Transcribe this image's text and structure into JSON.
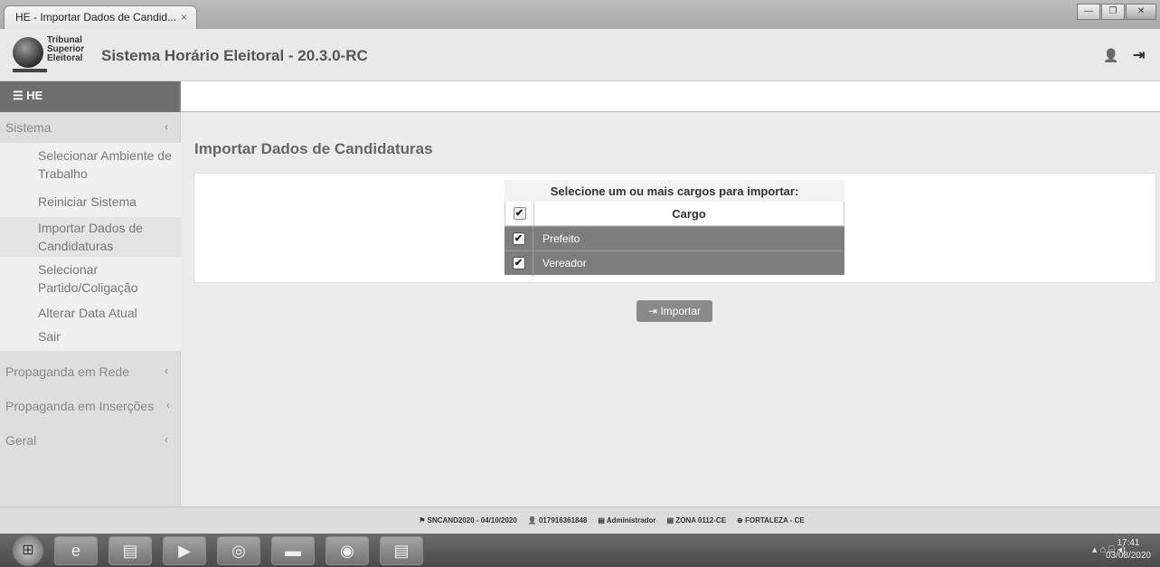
{
  "browser": {
    "tab_title": "HE - Importar Dados de Candid...",
    "tab_close": "×",
    "win_min": "—",
    "win_max": "❐",
    "win_close": "✕"
  },
  "header": {
    "org_line1": "Tribunal",
    "org_line2": "Superior",
    "org_line3": "Eleitoral",
    "app_title": "Sistema Horário Eleitoral - 20.3.0-RC",
    "user_icon": "👤",
    "logout_icon": "⇥"
  },
  "menu": {
    "toggle_label": "☰ HE"
  },
  "sidebar": {
    "sistema": {
      "label": "Sistema",
      "chev": "‹"
    },
    "sub": [
      "Selecionar Ambiente de Trabalho",
      "Reiniciar Sistema",
      "Importar Dados de Candidaturas",
      "Selecionar Partido/Coligação",
      "Alterar Data Atual",
      "Sair"
    ],
    "propaganda_rede": {
      "label": "Propaganda em Rede",
      "chev": "‹"
    },
    "propaganda_insercoes": {
      "label": "Propaganda em Inserções",
      "chev": "‹"
    },
    "geral": {
      "label": "Geral",
      "chev": "‹"
    }
  },
  "main": {
    "title": "Importar Dados de Candidaturas",
    "table_caption": "Selecione um ou mais cargos para importar:",
    "column_header": "Cargo",
    "rows": [
      "Prefeito",
      "Vereador"
    ],
    "check": "✔",
    "import_button": "⇥ Importar"
  },
  "status": {
    "base": "⚑ SNCAND2020 - 04/10/2020",
    "user": "👤 017916361848",
    "role": "▤ Administrador",
    "zona": "▤ ZONA 0112-CE",
    "city": "⊕ FORTALEZA  -  CE"
  },
  "taskbar": {
    "start": "⊞",
    "ie": "e",
    "files": "▤",
    "media": "▶",
    "chrome": "◎",
    "screen": "▬",
    "globe": "◉",
    "doc": "▤",
    "tray": "▴  ⌂  ⌸  ◂)",
    "time": "17:41",
    "date": "03/08/2020"
  }
}
